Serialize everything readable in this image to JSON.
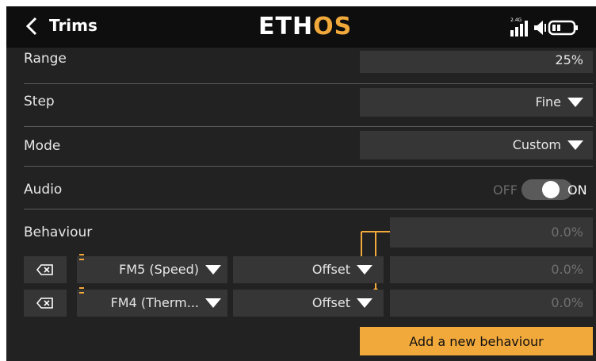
{
  "header": {
    "title": "Trims",
    "logo_main": "ETH",
    "logo_accent": "OS",
    "band_label": "2.4G"
  },
  "rows": {
    "range": {
      "label": "Range",
      "value": "25%"
    },
    "step": {
      "label": "Step",
      "value": "Fine"
    },
    "mode": {
      "label": "Mode",
      "value": "Custom"
    },
    "audio": {
      "label": "Audio",
      "off_label": "OFF",
      "on_label": "ON",
      "state": "on"
    },
    "behaviour": {
      "label": "Behaviour",
      "value": "0.0%"
    }
  },
  "behaviours": [
    {
      "flight_mode": "FM5 (Speed)",
      "type": "Offset",
      "value": "0.0%"
    },
    {
      "flight_mode": "FM4 (Therm...",
      "type": "Offset",
      "value": "0.0%"
    }
  ],
  "add_button": "Add a new behaviour",
  "colors": {
    "accent": "#f2a93b",
    "background": "#222222",
    "field": "#363636",
    "header": "#0e0e0e"
  },
  "icons": [
    "back-arrow-icon",
    "signal-strength-icon",
    "volume-icon",
    "battery-icon",
    "delete-icon",
    "dropdown-triangle-icon",
    "link-bracket-icon",
    "toggle-switch"
  ]
}
